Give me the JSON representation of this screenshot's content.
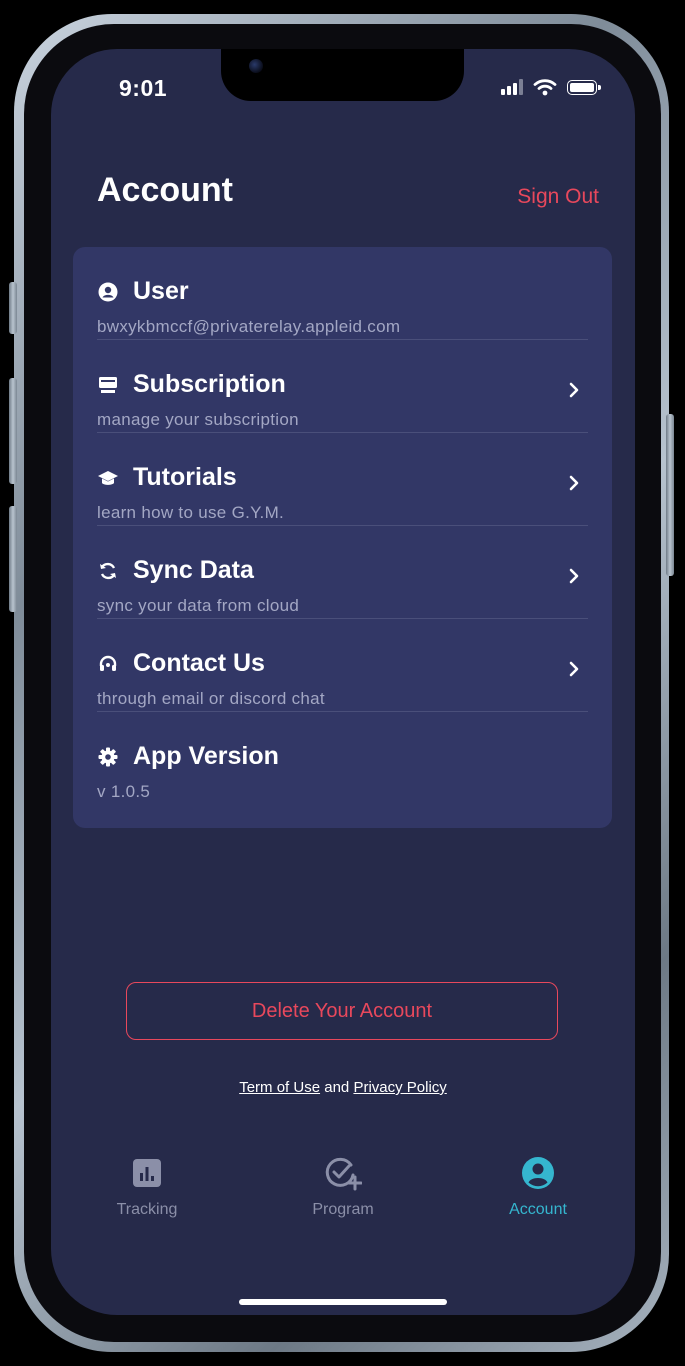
{
  "status_bar": {
    "time": "9:01"
  },
  "header": {
    "title": "Account",
    "sign_out_label": "Sign Out"
  },
  "menu": [
    {
      "icon": "user-circle-icon",
      "title": "User",
      "subtitle": "bwxykbmccf@privaterelay.appleid.com",
      "has_chevron": false
    },
    {
      "icon": "card-icon",
      "title": "Subscription",
      "subtitle": "manage your subscription",
      "has_chevron": true
    },
    {
      "icon": "graduation-cap-icon",
      "title": "Tutorials",
      "subtitle": "learn how to use G.Y.M.",
      "has_chevron": true
    },
    {
      "icon": "sync-icon",
      "title": "Sync Data",
      "subtitle": "sync your data from cloud",
      "has_chevron": true
    },
    {
      "icon": "headset-icon",
      "title": "Contact Us",
      "subtitle": "through email or discord chat",
      "has_chevron": true
    },
    {
      "icon": "gear-icon",
      "title": "App Version",
      "subtitle": "v 1.0.5",
      "has_chevron": false
    }
  ],
  "delete_button_label": "Delete Your Account",
  "legal": {
    "terms": "Term of Use",
    "and": "and",
    "privacy": "Privacy Policy"
  },
  "tabbar": {
    "tabs": [
      {
        "label": "Tracking",
        "icon": "bar-chart-icon",
        "active": false
      },
      {
        "label": "Program",
        "icon": "check-plus-icon",
        "active": false
      },
      {
        "label": "Account",
        "icon": "account-circle-icon",
        "active": true
      }
    ]
  },
  "colors": {
    "background": "#262a4a",
    "card": "#323766",
    "danger": "#e8485c",
    "accent": "#35b6cf"
  }
}
